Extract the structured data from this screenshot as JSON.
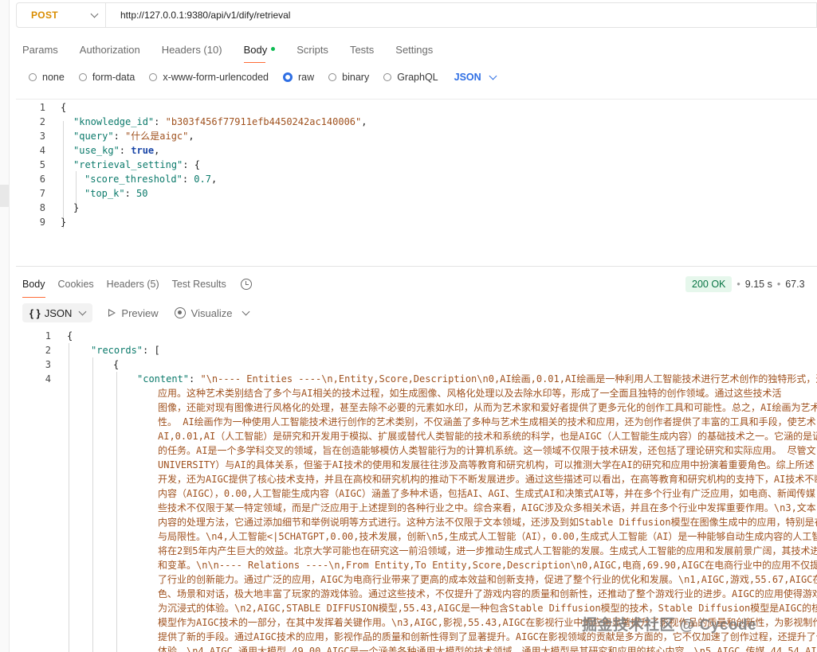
{
  "request": {
    "method": "POST",
    "url": "http://127.0.0.1:9380/api/v1/dify/retrieval",
    "tabs": [
      "Params",
      "Authorization",
      "Headers (10)",
      "Body",
      "Scripts",
      "Tests",
      "Settings"
    ],
    "active_tab": "Body",
    "body_types": [
      "none",
      "form-data",
      "x-www-form-urlencoded",
      "raw",
      "binary",
      "GraphQL"
    ],
    "selected_body_type": "raw",
    "format": "JSON",
    "editor": {
      "line_numbers": [
        "1",
        "2",
        "3",
        "4",
        "5",
        "6",
        "7",
        "8",
        "9"
      ],
      "knowledge_id_key": "\"knowledge_id\"",
      "knowledge_id_val": "\"b303f456f77911efb4450242ac140006\"",
      "query_key": "\"query\"",
      "query_val": "\"什么是aigc\"",
      "use_kg_key": "\"use_kg\"",
      "use_kg_val": "true",
      "retrieval_key": "\"retrieval_setting\"",
      "score_key": "\"score_threshold\"",
      "score_val": "0.7",
      "topk_key": "\"top_k\"",
      "topk_val": "50"
    }
  },
  "response": {
    "tabs": [
      "Body",
      "Cookies",
      "Headers (5)",
      "Test Results"
    ],
    "active_tab": "Body",
    "status": "200 OK",
    "time": "9.15 s",
    "size": "67.3",
    "format": "JSON",
    "preview_label": "Preview",
    "visualize_label": "Visualize",
    "line_numbers": [
      "1",
      "2",
      "3",
      "4"
    ],
    "records_key": "\"records\"",
    "content_key": "\"content\"",
    "content_lines": [
      "\"\\n---- Entities ----\\n,Entity,Score,Description\\n0,AI绘画,0.01,AI绘画是一种利用人工智能技术进行艺术创作的独特形式，这",
      "应用。这种艺术类别结合了多个与AI相关的技术过程，如生成图像、风格化处理以及去除水印等，形成了一全面且独特的创作领域。通过这些技术活",
      "图像，还能对现有图像进行风格化的处理，甚至去除不必要的元素如水印，从而为艺术家和爱好者提供了更多元化的创作工具和可能性。总之，AI绘画为艺术",
      "性。  AI绘画作为一种使用人工智能技术进行创作的艺术类别，不仅涵盖了多种与艺术生成相关的技术和应用，还为创作者提供了丰富的工具和手段，使艺术",
      "AI,0.01,AI（人工智能）是研究和开发用于模拟、扩展或替代人类智能的技术和系统的科学，也是AIGC（人工智能生成内容）的基础技术之一。它涵的是证",
      "的任务。AI是一个多学科交叉的领域，旨在创造能够模仿人类智能行为的计算机系统。这一领域不仅限于技术研发，还包括了理论研究和实际应用。  尽管文",
      "UNIVERSITY）与AI的具体关系，但鉴于AI技术的使用和发展往往涉及高等教育和研究机构，可以推测大学在AI的研究和应用中扮演着重要角色。综上所述",
      "开发，还为AIGC提供了核心技术支持，并且在高校和研究机构的推动下不断发展进步。通过这些描述可以看出，在高等教育和研究机构的支持下，AI技术不断",
      "内容（AIGC），0.00,人工智能生成内容（AIGC）涵盖了多种术语，包括AI、AGI、生成式AI和决策式AI等，并在多个行业有广泛应用，如电商、新闻传媒",
      "些技术不仅限于某一特定领域，而是广泛应用于上述提到的各种行业之中。综合来看，AIGC涉及众多相关术语，并且在多个行业中发挥重要作用。\\n3,文本",
      "内容的处理方法，它通过添加细节和举例说明等方式进行。这种方法不仅限于文本领域，还涉及到如Stable Diffusion模型在图像生成中的应用，特别是在",
      "与局限性。\\n4,人工智能<|5CHATGPT,0.00,技术发展，创新\\n5,生成式人工智能（AI），0.00,生成式人工智能（AI）是一种能够自动生成内容的人工智",
      "将在2到5年内产生巨大的效益。北京大学可能也在研究这一前沿领域，进一步推动生成式人工智能的发展。生成式人工智能的应用和发展前景广阔，其技术进",
      "和变革。\\n\\n---- Relations ----\\n,From Entity,To Entity,Score,Description\\n0,AIGC,电商,69.90,AIGC在电商行业中的应用不仅提",
      "了行业的创新能力。通过广泛的应用，AIGC为电商行业带来了更高的成本效益和创新支持，促进了整个行业的优化和发展。\\n1,AIGC,游戏,55.67,AIGC在",
      "色、场景和对话，极大地丰富了玩家的游戏体验。通过这些技术，不仅提升了游戏内容的质量和创新性，还推动了整个游戏行业的进步。AIGC的应用使得游戏",
      "为沉浸式的体验。\\n2,AIGC,STABLE DIFFUSION模型,55.43,AIGC是一种包含Stable Diffusion模型的技术，Stable Diffusion模型是AIGC的核心",
      "模型作为AIGC技术的一部分，在其中发挥着关键作用。\\n3,AIGC,影视,55.43,AIGC在影视行业中的应用显著提升了影视作品的质量和创新性，为影视制作带来了",
      "提供了新的手段。通过AIGC技术的应用，影视作品的质量和创新性得到了显著提升。AIGC在影视领域的贡献是多方面的，它不仅加速了创作过程，还提升了作",
      "体验。\\n4,AIGC,通用大模型,49.00,AIGC是一个涵盖各种通用大模型的技术领域，通用大模型是其研究和应用的核心内容。\\n5,AIGC,传媒,44.54,AIGC"
    ]
  },
  "watermark": "掘金技术社区 @ Cycode"
}
